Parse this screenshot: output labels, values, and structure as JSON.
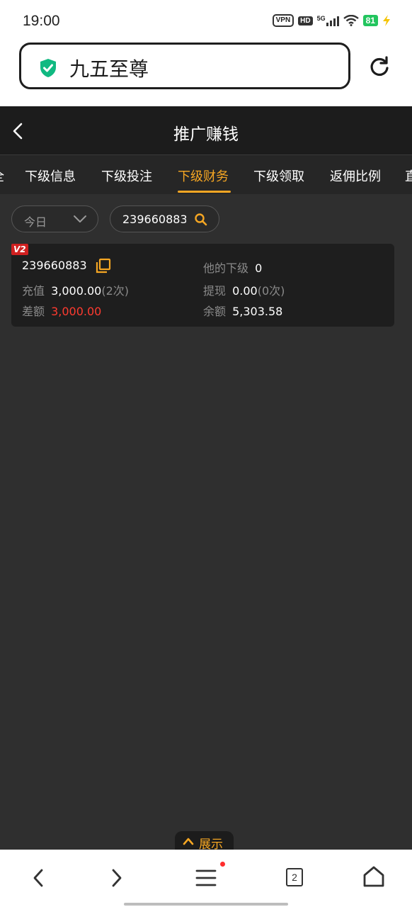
{
  "status_bar": {
    "time": "19:00",
    "vpn_label": "VPN",
    "hd_label": "HD",
    "network_label": "5G",
    "battery_level": "81",
    "icons": [
      "vpn-icon",
      "hd-icon",
      "signal-icon",
      "wifi-icon",
      "battery-icon",
      "charging-icon"
    ]
  },
  "browser": {
    "url_title": "九五至尊",
    "icons": [
      "shield-check-icon",
      "reload-icon"
    ]
  },
  "header": {
    "title": "推广赚钱",
    "icons": [
      "back-icon"
    ]
  },
  "tabs": [
    {
      "label": "下级信息"
    },
    {
      "label": "下级投注"
    },
    {
      "label": "下级财务",
      "active": true
    },
    {
      "label": "下级领取"
    },
    {
      "label": "返佣比例"
    }
  ],
  "filters": {
    "date_value": "今日",
    "search_value": "239660883"
  },
  "record": {
    "level_badge": "V2",
    "user_id": "239660883",
    "sub_label": "他的下级",
    "sub_value": "0",
    "recharge_label": "充值",
    "recharge_value": "3,000.00",
    "recharge_count": "(2次)",
    "withdraw_label": "提现",
    "withdraw_value": "0.00",
    "withdraw_count": "(0次)",
    "diff_label": "差额",
    "diff_value": "3,000.00",
    "balance_label": "余额",
    "balance_value": "5,303.58"
  },
  "expand_button": {
    "label": "展示"
  },
  "browser_nav": {
    "tab_count": "2",
    "icons": [
      "back-arrow-icon",
      "forward-arrow-icon",
      "menu-icon",
      "tabs-icon",
      "home-icon"
    ]
  },
  "colors": {
    "accent": "#f5a623",
    "negative": "#ff3b30",
    "page_bg": "#2f2f2f",
    "card_bg": "#1e1e1e",
    "badge_red": "#d02020"
  }
}
